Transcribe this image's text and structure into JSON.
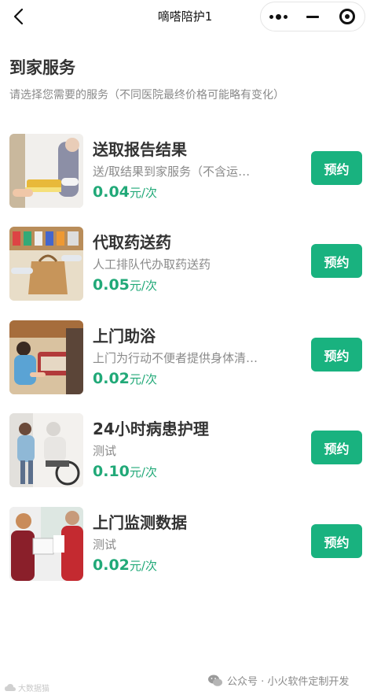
{
  "navbar": {
    "title": "嘀嗒陪护1",
    "back_icon": "chevron-left-icon",
    "more_icon": "more-dots-icon",
    "minimize_icon": "minus-icon",
    "close_icon": "target-circle-icon"
  },
  "header": {
    "title": "到家服务",
    "subtitle": "请选择您需要的服务（不同医院最终价格可能略有变化）"
  },
  "services": [
    {
      "title": "送取报告结果",
      "desc": "送/取结果到家服务（不含运费）",
      "price": "0.04",
      "unit": "元/次",
      "button": "预约"
    },
    {
      "title": "代取药送药",
      "desc": "人工排队代办取药送药",
      "price": "0.05",
      "unit": "元/次",
      "button": "预约"
    },
    {
      "title": "上门助浴",
      "desc": "上门为行动不便者提供身体清洁服务",
      "price": "0.02",
      "unit": "元/次",
      "button": "预约"
    },
    {
      "title": "24小时病患护理",
      "desc": "测试",
      "price": "0.10",
      "unit": "元/次",
      "button": "预约"
    },
    {
      "title": "上门监测数据",
      "desc": "测试",
      "price": "0.02",
      "unit": "元/次",
      "button": "预约"
    }
  ],
  "footer": {
    "watermark_left": "大数据猫",
    "watermark_right": "公众号 · 小火软件定制开发"
  },
  "colors": {
    "accent": "#19b27f",
    "price": "#21a978",
    "muted": "#8a8a8a"
  }
}
